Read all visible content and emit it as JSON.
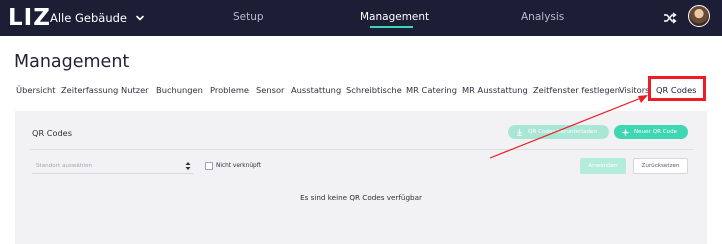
{
  "app": {
    "logo": "LIZ",
    "building_selector": "Alle Gebäude"
  },
  "nav": {
    "items": [
      "Setup",
      "Management",
      "Analysis"
    ],
    "active": "Management"
  },
  "page": {
    "title": "Management"
  },
  "tabs": [
    "Übersicht",
    "Zeiterfassung",
    "Nutzer",
    "Buchungen",
    "Probleme",
    "Sensor",
    "Ausstattung",
    "Schreibtische",
    "MR Catering",
    "MR Ausstattung",
    "Zeitfenster festlegen",
    "Visitors",
    "QR Codes"
  ],
  "active_tab": "QR Codes",
  "card": {
    "title": "QR Codes",
    "download_button": "QR Codes herunterladen",
    "new_button": "Neuer QR Code",
    "location_placeholder": "Standort auswählen",
    "unlinked_label": "Nicht verknüpft",
    "apply_button": "Anwenden",
    "reset_button": "Zurücksetzen",
    "empty_message": "Es sind keine QR Codes verfügbar"
  },
  "colors": {
    "topbar": "#1c1e36",
    "accent": "#3fd6b3",
    "annotation": "#ee1c24"
  }
}
